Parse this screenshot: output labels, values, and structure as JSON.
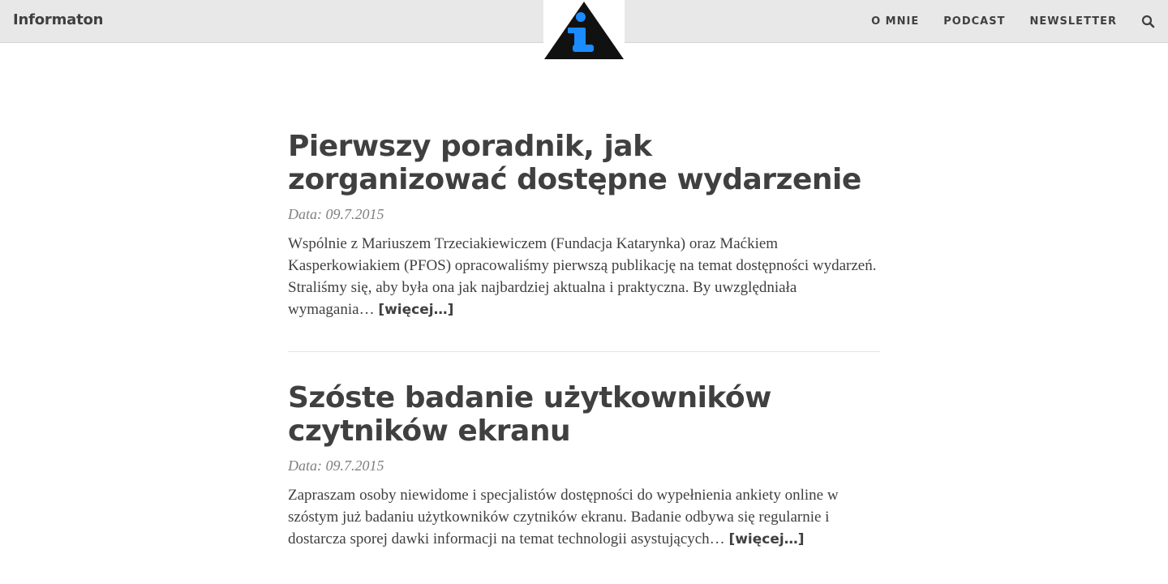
{
  "header": {
    "brand": "Informaton",
    "nav": [
      "O MNIE",
      "PODCAST",
      "NEWSLETTER"
    ],
    "search_icon": "search-icon",
    "logo_icon": "info-triangle-logo"
  },
  "colors": {
    "header_bg": "#e8e8e8",
    "text": "#404040",
    "meta": "#808080",
    "logo_accent": "#1a8cff"
  },
  "posts": [
    {
      "title": "Pierwszy poradnik, jak zorganizować dostępne wydarzenie",
      "date": "Data: 09.7.2015",
      "excerpt": "Wspólnie z Mariuszem Trzeciakiewiczem (Fundacja Katarynka) oraz Maćkiem Kasperkowiakiem (PFOS) opracowaliśmy pierwszą publikację na temat dostępności wydarzeń. Straliśmy się, aby była ona jak najbardziej aktualna i praktyczna. By uwzględniała wymagania…",
      "more": "[więcej…]"
    },
    {
      "title": "Szóste badanie użytkowników czytników ekranu",
      "date": "Data: 09.7.2015",
      "excerpt": "Zapraszam osoby niewidome i specjalistów dostępności do wypełnienia ankiety online w szóstym już badaniu użytkowników czytników ekranu. Badanie odbywa się regularnie i dostarcza sporej dawki informacji na temat technologii asystujących…",
      "more": "[więcej…]"
    }
  ]
}
